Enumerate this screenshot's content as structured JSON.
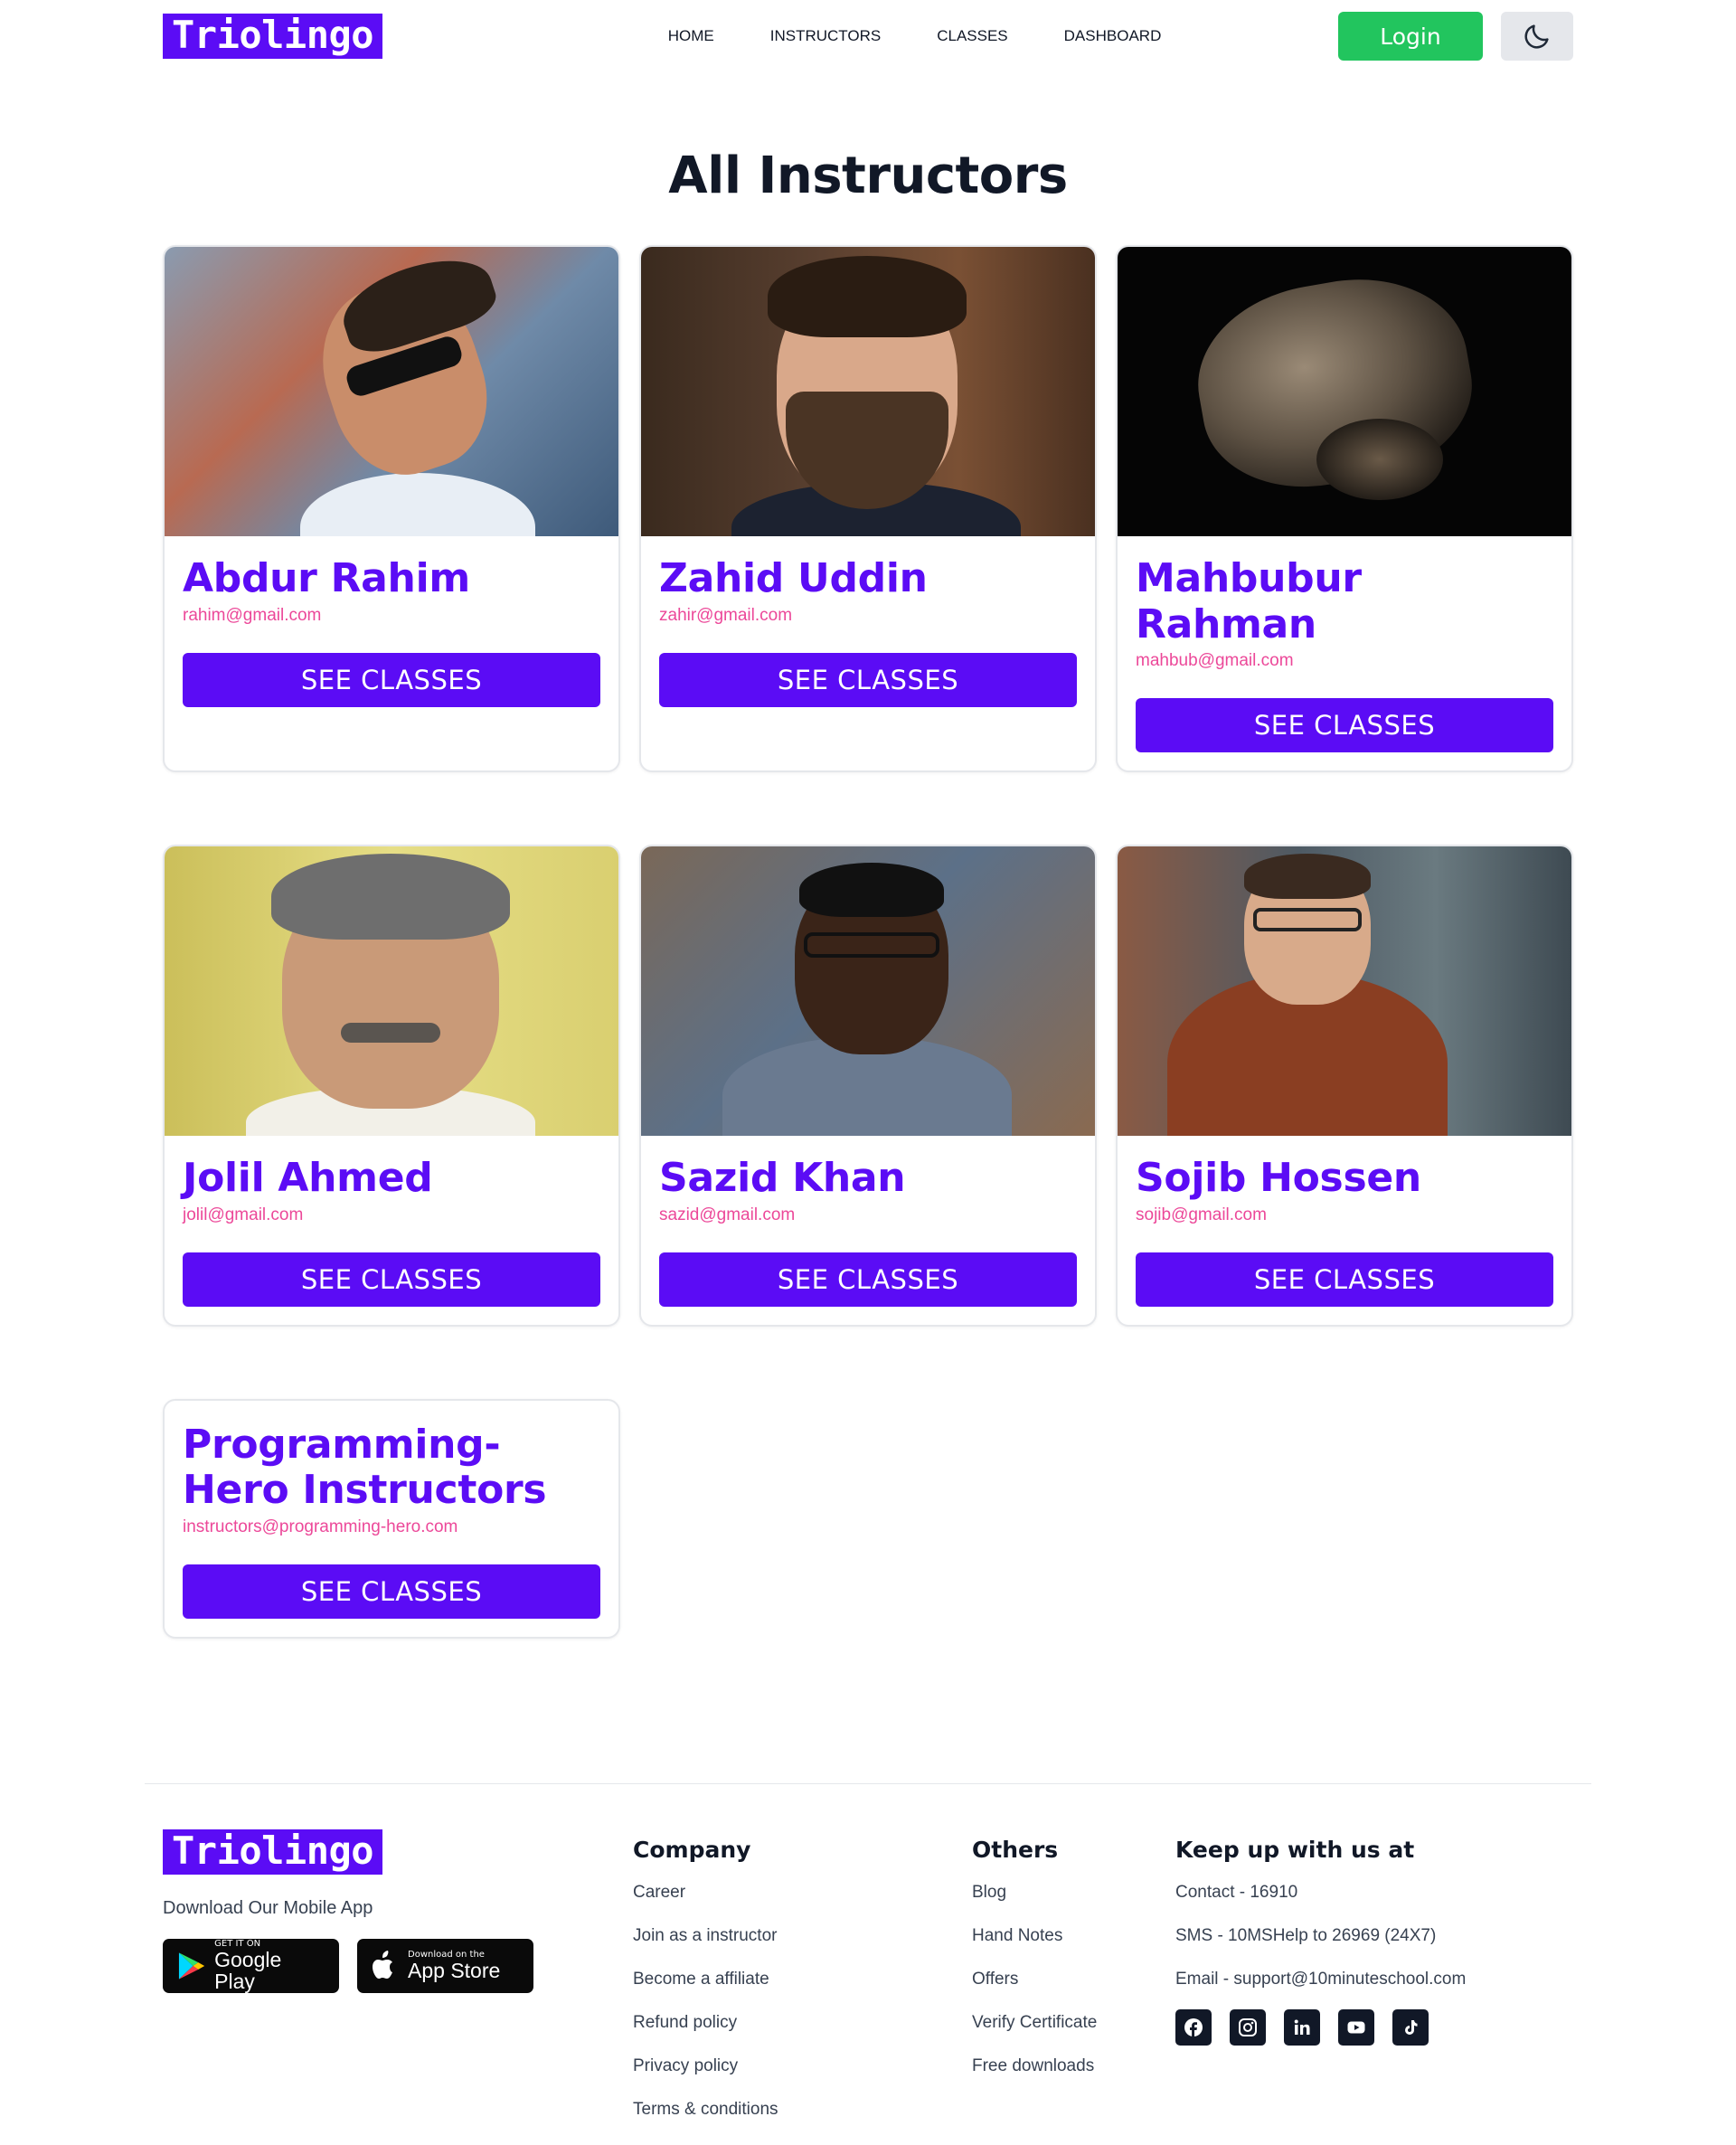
{
  "header": {
    "logo": "Triolingo",
    "nav": [
      "HOME",
      "INSTRUCTORS",
      "CLASSES",
      "DASHBOARD"
    ],
    "login_label": "Login",
    "theme_icon": "moon-icon"
  },
  "main": {
    "title": "All Instructors",
    "see_label": "SEE CLASSES",
    "instructors": [
      {
        "name": "Abdur Rahim",
        "email": "rahim@gmail.com"
      },
      {
        "name": "Zahid Uddin",
        "email": "zahir@gmail.com"
      },
      {
        "name": "Mahbubur Rahman",
        "email": "mahbub@gmail.com"
      },
      {
        "name": "Jolil Ahmed",
        "email": "jolil@gmail.com"
      },
      {
        "name": "Sazid Khan",
        "email": "sazid@gmail.com"
      },
      {
        "name": "Sojib Hossen",
        "email": "sojib@gmail.com"
      },
      {
        "name": "Programming-Hero Instructors",
        "email": "instructors@programming-hero.com"
      }
    ]
  },
  "footer": {
    "logo": "Triolingo",
    "tagline": "Download Our Mobile App",
    "google_small": "GET IT ON",
    "google_big": "Google Play",
    "apple_small": "Download on the",
    "apple_big": "App Store",
    "company": {
      "heading": "Company",
      "links": [
        "Career",
        "Join as a instructor",
        "Become a affiliate",
        "Refund policy",
        "Privacy policy",
        "Terms & conditions"
      ]
    },
    "others": {
      "heading": "Others",
      "links": [
        "Blog",
        "Hand Notes",
        "Offers",
        "Verify Certificate",
        "Free downloads"
      ]
    },
    "contact": {
      "heading": "Keep up with us at",
      "lines": [
        "Contact - 16910",
        "SMS - 10MSHelp to 26969 (24X7)",
        "Email - support@10minuteschool.com"
      ]
    },
    "socials": [
      "facebook-icon",
      "instagram-icon",
      "linkedin-icon",
      "youtube-icon",
      "tiktok-icon"
    ]
  },
  "colors": {
    "brand": "#5b0cf5",
    "email": "#ec4899",
    "login": "#22c55e"
  }
}
